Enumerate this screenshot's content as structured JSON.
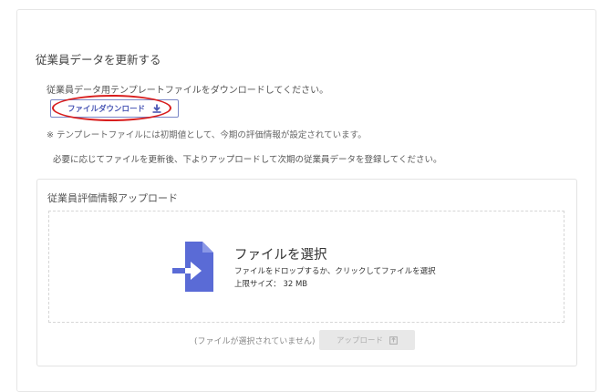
{
  "section": {
    "title": "従業員データを更新する",
    "instruction": "従業員データ用テンプレートファイルをダウンロードしてください。",
    "download_button": "ファイルダウンロード",
    "note": "※ テンプレートファイルには初期値として、今期の評価情報が設定されています。",
    "note2": "必要に応じてファイルを更新後、下よりアップロードして次期の従業員データを登録してください。"
  },
  "upload": {
    "title": "従業員評価情報アップロード",
    "select_title": "ファイルを選択",
    "drop_desc": "ファイルをドロップするか、クリックしてファイルを選択",
    "size_limit": "上限サイズ： 32 MB",
    "no_file": "(ファイルが選択されていません)",
    "upload_button": "アップロード"
  },
  "colors": {
    "accent": "#4a57b5",
    "highlight": "#d81e1e",
    "icon_blue": "#5a6bd6",
    "disabled_bg": "#e8e8e8"
  },
  "icons": {
    "download": "download-icon",
    "file": "file-import-icon",
    "upload": "upload-icon"
  }
}
